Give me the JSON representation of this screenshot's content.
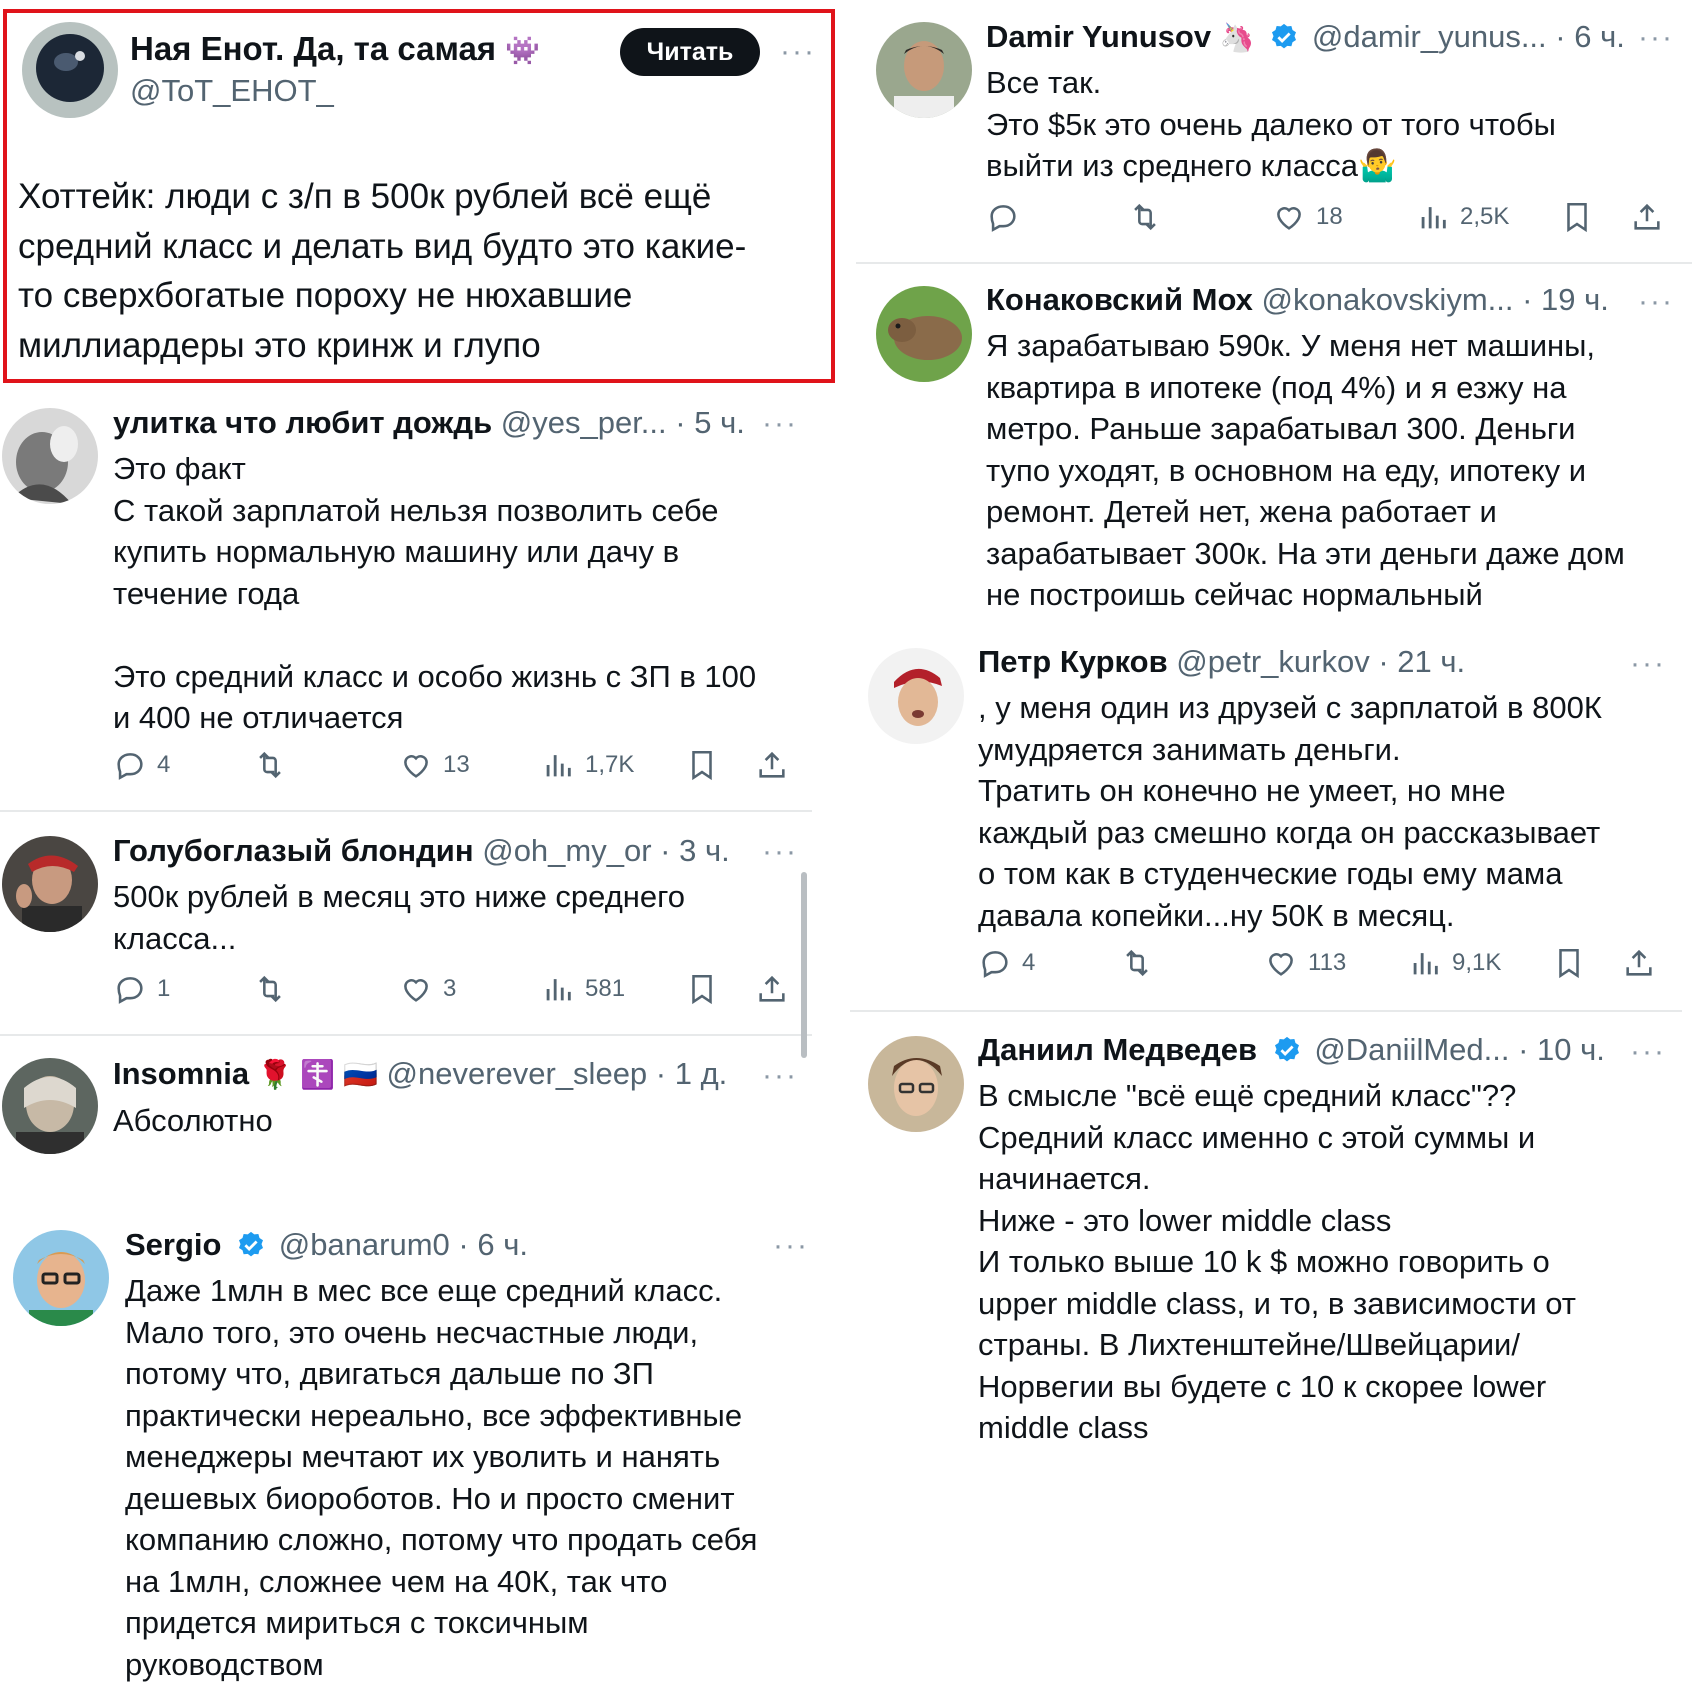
{
  "main_tweet": {
    "name": "Ная Енот. Да, та самая",
    "name_emoji": "👾",
    "handle": "@ToT_EHOT_",
    "read_label": "Читать",
    "more": "···",
    "text": "Хоттейк: люди с з/п в 500к рублей всё ещё\nсредний класс и делать вид будто это какие-\nто сверхбогатые пороху не нюхавшие\nмиллиардеры это кринж и глупо"
  },
  "left_replies": [
    {
      "name": "улитка что любит дождь",
      "handle": "@yes_per...",
      "time": "· 5 ч.",
      "more": "···",
      "text": "Это факт\nС такой зарплатой нельзя позволить себе\nкупить нормальную машину или дачу в\nтечение года\n\nЭто средний класс и особо жизнь с ЗП в 100\nи 400 не отличается",
      "replies": "4",
      "likes": "13",
      "views": "1,7K"
    },
    {
      "name": "Голубоглазый блондин",
      "handle": "@oh_my_or",
      "time": "· 3 ч.",
      "more": "···",
      "text": "500к рублей в месяц это ниже среднего\nкласса...",
      "replies": "1",
      "likes": "3",
      "views": "581"
    },
    {
      "name": "Insomnia",
      "name_emoji": "🌹 ☦️ 🇷🇺",
      "handle": "@neverever_sleep",
      "time": "· 1 д.",
      "more": "···",
      "text": "Абсолютно"
    },
    {
      "name": "Sergio",
      "handle": "@banarum0",
      "time": "· 6 ч.",
      "more": "···",
      "text": "Даже 1млн в мес все еще средний класс.\nМало того, это очень несчастные люди,\nпотому что, двигаться дальше по ЗП\nпрактически нереально, все эффективные\nменеджеры мечтают их уволить и нанять\nдешевых биороботов. Но и просто сменит\nкомпанию сложно, потому что продать себя\nна 1млн, сложнее чем на 40К, так что\nпридется мириться с токсичным\nруководством"
    }
  ],
  "right_replies": [
    {
      "name": "Damir Yunusov",
      "name_emoji": "🦄",
      "handle": "@damir_yunus...",
      "time": "· 6 ч.",
      "more": "···",
      "text": "Все так.\nЭто $5к это очень далеко от того чтобы\nвыйти из среднего класса🤷‍♂️",
      "likes": "18",
      "views": "2,5K"
    },
    {
      "name": "Конаковский Мох",
      "handle": "@konakovskiym...",
      "time": "· 19 ч.",
      "more": "···",
      "text": "Я зарабатываю 590к. У меня нет машины,\nквартира в ипотеке (под 4%) и я езжу на\nметро. Раньше зарабатывал 300. Деньги\nтупо уходят, в основном на еду, ипотеку и\nремонт. Детей нет, жена работает и\nзарабатывает 300к. На эти деньги даже дом\nне построишь сейчас нормальный"
    },
    {
      "name": "Петр Курков",
      "handle": "@petr_kurkov",
      "time": "· 21 ч.",
      "more": "···",
      "text": ", у меня один из друзей с зарплатой в 800К\nумудряется занимать деньги.\nТратить он конечно не умеет, но мне\nкаждый раз смешно когда он рассказывает\nо том как в студенческие годы ему мама\nдавала копейки...ну 50К в месяц.",
      "replies": "4",
      "likes": "113",
      "views": "9,1K"
    },
    {
      "name": "Даниил Медведев",
      "handle": "@DaniilMed...",
      "time": "· 10 ч.",
      "more": "···",
      "text": "В смысле \"всё ещё средний класс\"??\nСредний класс именно с этой суммы и\nначинается.\nНиже - это lower middle class\nИ только выше 10 k $ можно говорить о\nupper middle class, и то, в зависимости от\nстраны. В Лихтенштейне/Швейцарии/\nНорвегии вы будете с 10 к скорее lower\nmiddle class"
    }
  ],
  "colors": {
    "verified": "#1d9bf0",
    "highlight_border": "#e0131a",
    "muted": "#536471"
  }
}
